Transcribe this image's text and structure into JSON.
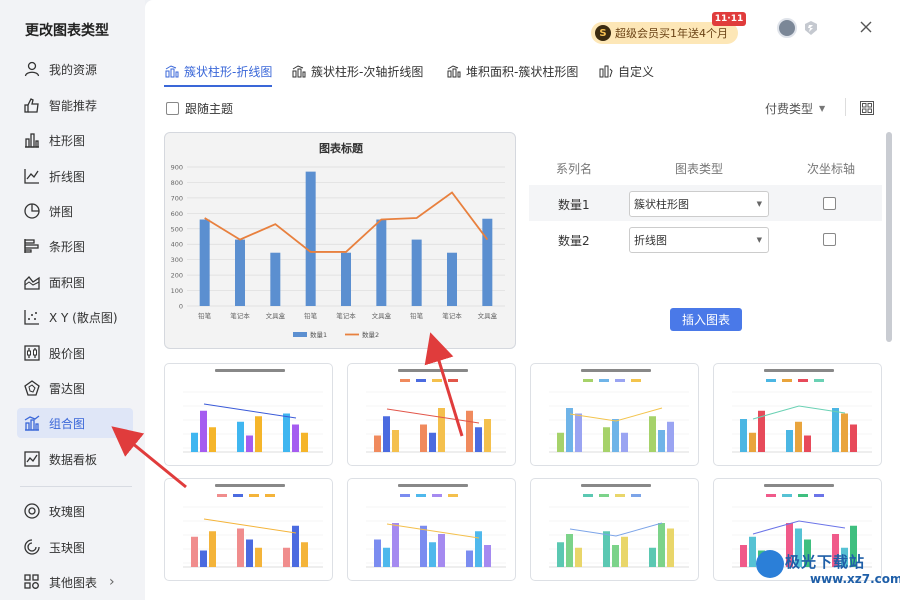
{
  "sidebar": {
    "title": "更改图表类型",
    "items": [
      {
        "label": "我的资源",
        "icon": "user-icon"
      },
      {
        "label": "智能推荐",
        "icon": "recommend-icon"
      },
      {
        "label": "柱形图",
        "icon": "column-chart-icon"
      },
      {
        "label": "折线图",
        "icon": "line-chart-icon"
      },
      {
        "label": "饼图",
        "icon": "pie-chart-icon"
      },
      {
        "label": "条形图",
        "icon": "bar-chart-icon"
      },
      {
        "label": "面积图",
        "icon": "area-chart-icon"
      },
      {
        "label": "X Y (散点图)",
        "icon": "scatter-chart-icon"
      },
      {
        "label": "股价图",
        "icon": "stock-chart-icon"
      },
      {
        "label": "雷达图",
        "icon": "radar-chart-icon"
      },
      {
        "label": "组合图",
        "icon": "combo-chart-icon"
      },
      {
        "label": "数据看板",
        "icon": "dashboard-icon"
      },
      {
        "label": "玫瑰图",
        "icon": "rose-chart-icon"
      },
      {
        "label": "玉玦图",
        "icon": "ring-chart-icon"
      },
      {
        "label": "其他图表",
        "icon": "other-chart-icon"
      }
    ],
    "active": "组合图"
  },
  "header": {
    "vip_text": "超级会员买1年送4个月",
    "vip_coin": "S",
    "promo_badge": "11·11"
  },
  "tabs": [
    {
      "label": "簇状柱形-折线图",
      "icon": "cluster-line-icon"
    },
    {
      "label": "簇状柱形-次轴折线图",
      "icon": "cluster-secondary-line-icon"
    },
    {
      "label": "堆积面积-簇状柱形图",
      "icon": "stacked-area-column-icon"
    },
    {
      "label": "自定义",
      "icon": "custom-icon"
    }
  ],
  "options": {
    "follow_theme": "跟随主题",
    "pay_type": "付费类型"
  },
  "preview": {
    "chart_data": {
      "type": "bar",
      "title": "图表标题",
      "categories": [
        "铅笔",
        "笔记本",
        "文具盒",
        "铅笔",
        "笔记本",
        "文具盒",
        "铅笔",
        "笔记本",
        "文具盒"
      ],
      "series": [
        {
          "name": "数量1",
          "type": "bar",
          "values": [
            560,
            430,
            345,
            870,
            345,
            560,
            430,
            345,
            565
          ]
        },
        {
          "name": "数量2",
          "type": "line",
          "values": [
            570,
            430,
            530,
            350,
            350,
            560,
            570,
            735,
            430
          ]
        }
      ],
      "ylim": [
        0,
        900
      ],
      "yticks": [
        0,
        100,
        200,
        300,
        400,
        500,
        600,
        700,
        800,
        900
      ],
      "grid": true,
      "legend": "bottom",
      "colors": {
        "bar": "#5b8fd0",
        "line": "#e8803e"
      }
    }
  },
  "series_table": {
    "headers": [
      "系列名",
      "图表类型",
      "次坐标轴"
    ],
    "rows": [
      {
        "name": "数量1",
        "type": "簇状柱形图"
      },
      {
        "name": "数量2",
        "type": "折线图"
      }
    ]
  },
  "insert_button": "插入图表",
  "watermark": {
    "text": "极光下载站",
    "url": "www.xz7.com"
  },
  "colors": {
    "accent": "#3a67d8",
    "button": "#4a79e8",
    "arrow": "#e03c3c"
  }
}
